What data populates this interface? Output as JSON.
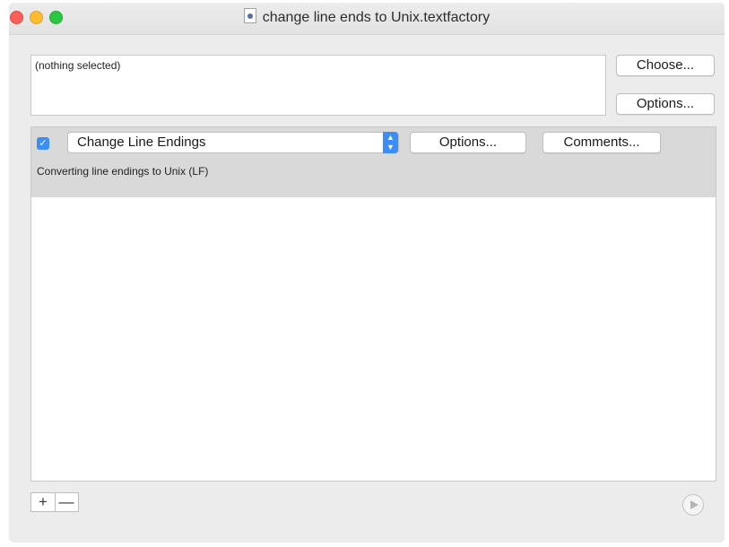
{
  "window": {
    "title": "change line ends to Unix.textfactory",
    "doc_icon": "textfactory-document-icon"
  },
  "source": {
    "text": "(nothing selected)",
    "choose_label": "Choose...",
    "options_label": "Options..."
  },
  "actions": [
    {
      "checked": true,
      "name": "Change Line Endings",
      "options_label": "Options...",
      "comments_label": "Comments...",
      "description": "Converting line endings to Unix (LF)"
    }
  ],
  "footer": {
    "add_label": "+",
    "remove_label": "—",
    "run_icon": "play-icon"
  },
  "colors": {
    "accent": "#3b8ef5",
    "selected_row": "#d9d9d9",
    "window_bg": "#ececec"
  }
}
